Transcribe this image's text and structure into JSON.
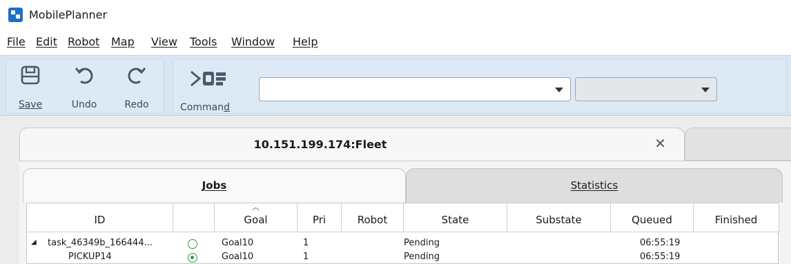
{
  "app": {
    "title": "MobilePlanner"
  },
  "menu": [
    "File",
    "Edit",
    "Robot",
    "Map",
    "View",
    "Tools",
    "Window",
    "Help"
  ],
  "toolbar": {
    "save_label": "Save",
    "undo_label": "Undo",
    "redo_label": "Redo",
    "command_label": "Command",
    "command_icon": "command-terminal-icon",
    "command_input_value": "",
    "robot_select_value": ""
  },
  "panel_tab": {
    "label": "10.151.199.174:Fleet"
  },
  "subtabs": {
    "jobs": "Jobs",
    "statistics": "Statistics"
  },
  "table": {
    "columns": [
      "ID",
      "",
      "Goal",
      "Pri",
      "Robot",
      "State",
      "Substate",
      "Queued",
      "Finished"
    ],
    "sorted_column": "Goal",
    "rows": [
      {
        "id": "task_46349b_166444...",
        "status": "open-circle-icon",
        "goal": "Goal10",
        "pri": "1",
        "robot": "",
        "state": "Pending",
        "substate": "",
        "queued": "06:55:19",
        "finished": ""
      },
      {
        "id": "PICKUP14",
        "status": "dot-circle-icon",
        "goal": "Goal10",
        "pri": "1",
        "robot": "",
        "state": "Pending",
        "substate": "",
        "queued": "06:55:19",
        "finished": ""
      }
    ]
  },
  "colors": {
    "toolbar_bg": "#d9e7f4",
    "status_green": "#2e9a3a",
    "app_icon": "#1e6fc7"
  }
}
